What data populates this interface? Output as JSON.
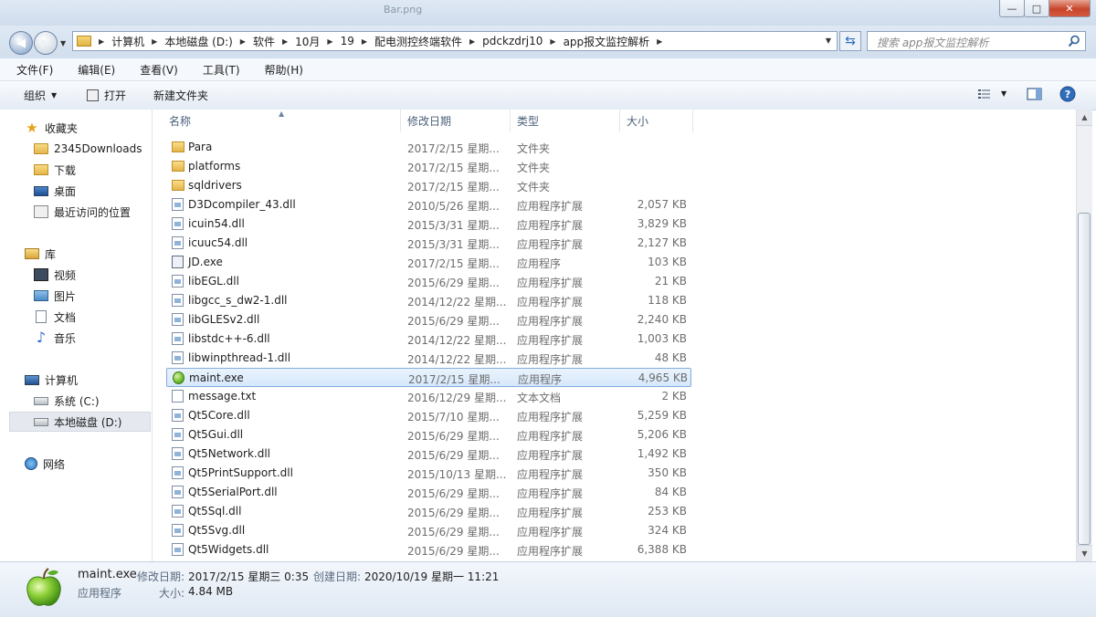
{
  "window": {
    "title": "Bar.png",
    "minimize": "—",
    "maximize": "□",
    "close": "✕"
  },
  "address": {
    "crumbs": [
      "计算机",
      "本地磁盘 (D:)",
      "软件",
      "10月",
      "19",
      "配电测控终端软件",
      "pdckzdrj10",
      "app报文监控解析"
    ],
    "search_placeholder": "搜索 app报文监控解析"
  },
  "menu": [
    "文件(F)",
    "编辑(E)",
    "查看(V)",
    "工具(T)",
    "帮助(H)"
  ],
  "toolbar": {
    "organize": "组织",
    "open": "打开",
    "new_folder": "新建文件夹"
  },
  "nav": {
    "favorites": "收藏夹",
    "fav_items": [
      "2345Downloads",
      "下载",
      "桌面",
      "最近访问的位置"
    ],
    "libraries": "库",
    "lib_items": [
      "视频",
      "图片",
      "文档",
      "音乐"
    ],
    "computer": "计算机",
    "drives": [
      "系统 (C:)",
      "本地磁盘 (D:)"
    ],
    "network": "网络"
  },
  "columns": {
    "name": "名称",
    "date": "修改日期",
    "type": "类型",
    "size": "大小"
  },
  "files": [
    {
      "name": "Para",
      "date": "2017/2/15 星期...",
      "type": "文件夹",
      "size": "",
      "icon": "folder"
    },
    {
      "name": "platforms",
      "date": "2017/2/15 星期...",
      "type": "文件夹",
      "size": "",
      "icon": "folder"
    },
    {
      "name": "sqldrivers",
      "date": "2017/2/15 星期...",
      "type": "文件夹",
      "size": "",
      "icon": "folder"
    },
    {
      "name": "D3Dcompiler_43.dll",
      "date": "2010/5/26 星期...",
      "type": "应用程序扩展",
      "size": "2,057 KB",
      "icon": "dll"
    },
    {
      "name": "icuin54.dll",
      "date": "2015/3/31 星期...",
      "type": "应用程序扩展",
      "size": "3,829 KB",
      "icon": "dll"
    },
    {
      "name": "icuuc54.dll",
      "date": "2015/3/31 星期...",
      "type": "应用程序扩展",
      "size": "2,127 KB",
      "icon": "dll"
    },
    {
      "name": "JD.exe",
      "date": "2017/2/15 星期...",
      "type": "应用程序",
      "size": "103 KB",
      "icon": "exe"
    },
    {
      "name": "libEGL.dll",
      "date": "2015/6/29 星期...",
      "type": "应用程序扩展",
      "size": "21 KB",
      "icon": "dll"
    },
    {
      "name": "libgcc_s_dw2-1.dll",
      "date": "2014/12/22 星期...",
      "type": "应用程序扩展",
      "size": "118 KB",
      "icon": "dll"
    },
    {
      "name": "libGLESv2.dll",
      "date": "2015/6/29 星期...",
      "type": "应用程序扩展",
      "size": "2,240 KB",
      "icon": "dll"
    },
    {
      "name": "libstdc++-6.dll",
      "date": "2014/12/22 星期...",
      "type": "应用程序扩展",
      "size": "1,003 KB",
      "icon": "dll"
    },
    {
      "name": "libwinpthread-1.dll",
      "date": "2014/12/22 星期...",
      "type": "应用程序扩展",
      "size": "48 KB",
      "icon": "dll"
    },
    {
      "name": "maint.exe",
      "date": "2017/2/15 星期...",
      "type": "应用程序",
      "size": "4,965 KB",
      "icon": "apple",
      "selected": true
    },
    {
      "name": "message.txt",
      "date": "2016/12/29 星期...",
      "type": "文本文档",
      "size": "2 KB",
      "icon": "txt"
    },
    {
      "name": "Qt5Core.dll",
      "date": "2015/7/10 星期...",
      "type": "应用程序扩展",
      "size": "5,259 KB",
      "icon": "dll"
    },
    {
      "name": "Qt5Gui.dll",
      "date": "2015/6/29 星期...",
      "type": "应用程序扩展",
      "size": "5,206 KB",
      "icon": "dll"
    },
    {
      "name": "Qt5Network.dll",
      "date": "2015/6/29 星期...",
      "type": "应用程序扩展",
      "size": "1,492 KB",
      "icon": "dll"
    },
    {
      "name": "Qt5PrintSupport.dll",
      "date": "2015/10/13 星期...",
      "type": "应用程序扩展",
      "size": "350 KB",
      "icon": "dll"
    },
    {
      "name": "Qt5SerialPort.dll",
      "date": "2015/6/29 星期...",
      "type": "应用程序扩展",
      "size": "84 KB",
      "icon": "dll"
    },
    {
      "name": "Qt5Sql.dll",
      "date": "2015/6/29 星期...",
      "type": "应用程序扩展",
      "size": "253 KB",
      "icon": "dll"
    },
    {
      "name": "Qt5Svg.dll",
      "date": "2015/6/29 星期...",
      "type": "应用程序扩展",
      "size": "324 KB",
      "icon": "dll"
    },
    {
      "name": "Qt5Widgets.dll",
      "date": "2015/6/29 星期...",
      "type": "应用程序扩展",
      "size": "6,388 KB",
      "icon": "dll"
    }
  ],
  "details": {
    "filename": "maint.exe",
    "modified_label": "修改日期:",
    "modified_value": "2017/2/15 星期三 0:35",
    "created_label": "创建日期:",
    "created_value": "2020/10/19 星期一 11:21",
    "type": "应用程序",
    "size_label": "大小:",
    "size_value": "4.84 MB"
  }
}
